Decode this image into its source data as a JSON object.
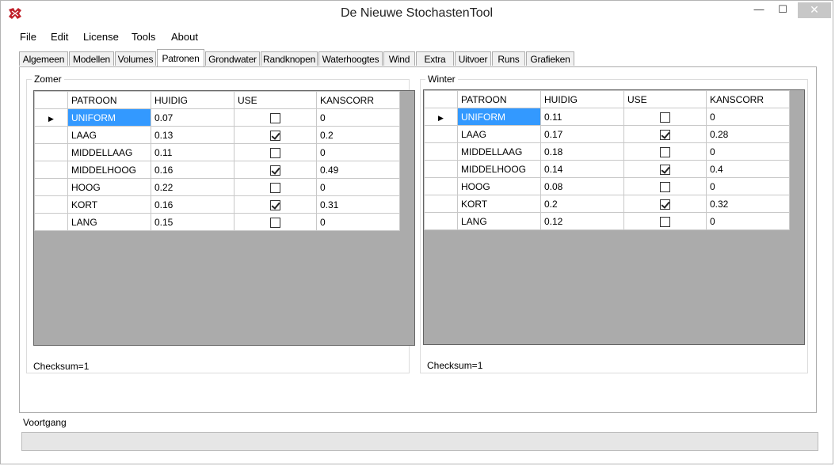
{
  "window": {
    "title": "De Nieuwe StochastenTool",
    "controls": {
      "minimize": "—",
      "maximize": "☐",
      "close": "✕"
    }
  },
  "menu": [
    "File",
    "Edit",
    "License",
    "Tools",
    "About"
  ],
  "tabs": [
    "Algemeen",
    "Modellen",
    "Volumes",
    "Patronen",
    "Grondwater",
    "Randknopen",
    "Waterhoogtes",
    "Wind",
    "Extra",
    "Uitvoer",
    "Runs",
    "Grafieken"
  ],
  "active_tab": "Patronen",
  "columns": [
    "PATROON",
    "HUIDIG",
    "USE",
    "KANSCORR"
  ],
  "zomer": {
    "title": "Zomer",
    "rows": [
      {
        "patroon": "UNIFORM",
        "huidig": "0.07",
        "use": false,
        "kanscorr": "0"
      },
      {
        "patroon": "LAAG",
        "huidig": "0.13",
        "use": true,
        "kanscorr": "0.2"
      },
      {
        "patroon": "MIDDELLAAG",
        "huidig": "0.11",
        "use": false,
        "kanscorr": "0"
      },
      {
        "patroon": "MIDDELHOOG",
        "huidig": "0.16",
        "use": true,
        "kanscorr": "0.49"
      },
      {
        "patroon": "HOOG",
        "huidig": "0.22",
        "use": false,
        "kanscorr": "0"
      },
      {
        "patroon": "KORT",
        "huidig": "0.16",
        "use": true,
        "kanscorr": "0.31"
      },
      {
        "patroon": "LANG",
        "huidig": "0.15",
        "use": false,
        "kanscorr": "0"
      }
    ],
    "checksum": "Checksum=1"
  },
  "winter": {
    "title": "Winter",
    "rows": [
      {
        "patroon": "UNIFORM",
        "huidig": "0.11",
        "use": false,
        "kanscorr": "0"
      },
      {
        "patroon": "LAAG",
        "huidig": "0.17",
        "use": true,
        "kanscorr": "0.28"
      },
      {
        "patroon": "MIDDELLAAG",
        "huidig": "0.18",
        "use": false,
        "kanscorr": "0"
      },
      {
        "patroon": "MIDDELHOOG",
        "huidig": "0.14",
        "use": true,
        "kanscorr": "0.4"
      },
      {
        "patroon": "HOOG",
        "huidig": "0.08",
        "use": false,
        "kanscorr": "0"
      },
      {
        "patroon": "KORT",
        "huidig": "0.2",
        "use": true,
        "kanscorr": "0.32"
      },
      {
        "patroon": "LANG",
        "huidig": "0.12",
        "use": false,
        "kanscorr": "0"
      }
    ],
    "checksum": "Checksum=1"
  },
  "progress": {
    "label": "Voortgang",
    "value": 0
  },
  "colors": {
    "selection": "#3399ff",
    "grid_background": "#ababab",
    "close_button": "#c7c7c7",
    "progress_fill": "#06b025"
  }
}
